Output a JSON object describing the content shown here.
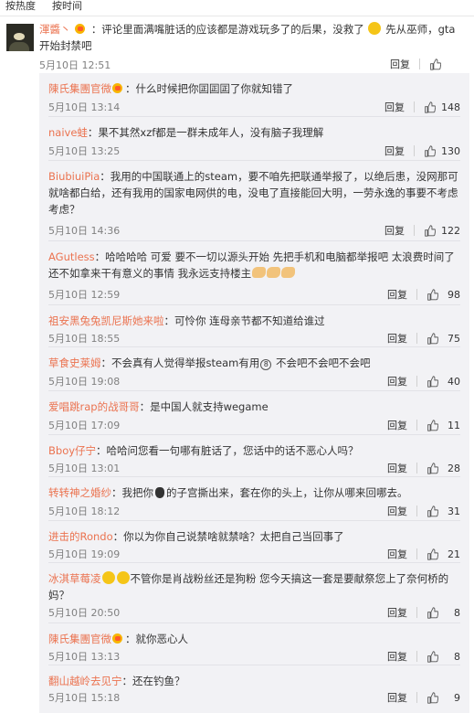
{
  "sort": {
    "hot": "按热度",
    "time": "按时间"
  },
  "main_comment": {
    "user": "渾醬丶",
    "text_a": "：评论里面满嘴脏话的应该都是游戏玩多了的后果，没救了",
    "text_b": "先从巫师，gta开始封禁吧",
    "time": "5月10日 12:51",
    "reply_label": "回复",
    "likes": ""
  },
  "replies": [
    {
      "user": "陳氏集團官微",
      "vip": true,
      "text": "：什么时候把你囸囸囸了你就知错了",
      "time": "5月10日 13:14",
      "reply_label": "回复",
      "likes": "148"
    },
    {
      "user": "naive蛙",
      "text": "：果不其然xzf都是一群未成年人，没有脑子我理解",
      "time": "5月10日 13:25",
      "reply_label": "回复",
      "likes": "130"
    },
    {
      "user": "BiubiuiPia",
      "text": "：我用的中国联通上的steam，要不咱先把联通举报了，以绝后患，没网那可就啥都白给，还有我用的国家电网供的电，没电了直接能回大明，一劳永逸的事要不考虑考虑？",
      "time": "5月10日 14:36",
      "reply_label": "回复",
      "likes": "122"
    },
    {
      "user": "AGutless",
      "text": "：哈哈哈哈 可爱 要不一切以源头开始 先把手机和电脑都举报吧 太浪费时间了 还不如拿来干有意义的事情 我永远支持楼主",
      "time": "5月10日 12:59",
      "reply_label": "回复",
      "likes": "98"
    },
    {
      "user": "祖安黑兔兔凯尼斯她来啦",
      "text": "：可怜你 连母亲节都不知道给谁过",
      "time": "5月10日 18:55",
      "reply_label": "回复",
      "likes": "75"
    },
    {
      "user": "草食史莱姆",
      "text_a": "：不会真有人觉得举报steam有用",
      "circled": "⑧",
      "text_b": " 不会吧不会吧不会吧",
      "time": "5月10日 19:08",
      "reply_label": "回复",
      "likes": "40"
    },
    {
      "user": "爱唱跳rap的战哥哥",
      "text": "：是中国人就支持wegame",
      "time": "5月10日 17:09",
      "reply_label": "回复",
      "likes": "11"
    },
    {
      "user": "Bboy仔宁",
      "text": "：哈哈问您看一句哪有脏话了，您话中的话不恶心人吗？",
      "time": "5月10日 13:01",
      "reply_label": "回复",
      "likes": "28"
    },
    {
      "user": "转转神之婚纱",
      "text_a": "：我把你",
      "text_b": "的子宫撕出来，套在你的头上，让你从哪来回哪去。",
      "time": "5月10日 18:12",
      "reply_label": "回复",
      "likes": "31"
    },
    {
      "user": "进击的Rondo",
      "text": "：你以为你自己说禁啥就禁啥？太把自己当回事了",
      "time": "5月10日 19:09",
      "reply_label": "回复",
      "likes": "21"
    },
    {
      "user": "冰淇草莓凌",
      "text": "不管你是肖战粉丝还是狗粉 您今天搞这一套是要献祭您上了奈何桥的妈？",
      "time": "5月10日 20:50",
      "reply_label": "回复",
      "likes": "8"
    },
    {
      "user": "陳氏集團官微",
      "vip": true,
      "text": "：就你恶心人",
      "time": "5月10日 13:13",
      "reply_label": "回复",
      "likes": "8"
    },
    {
      "user": "翻山越岭去见宁",
      "text": "：还在钓鱼？",
      "time": "5月10日 15:18",
      "reply_label": "回复",
      "likes": "9"
    }
  ],
  "colors": {
    "username": "#eb7350",
    "meta": "#808080",
    "reply_bg": "#f2f2f5"
  },
  "icons": {
    "like": "thumbs-up-icon",
    "vip": "vip-badge-icon",
    "emoji": "smiley-emoji-icon"
  }
}
